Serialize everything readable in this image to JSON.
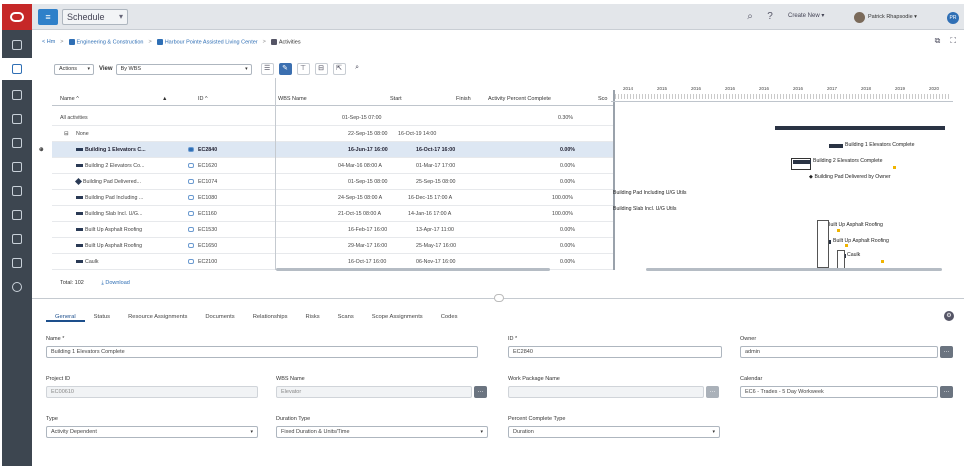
{
  "app": {
    "title": "Schedule",
    "app_icon_glyph": "≡",
    "create_new": "Create New ▾",
    "user_name": "Patrick Rhapsodie ▾",
    "user_badge": "PR"
  },
  "breadcrumb": [
    {
      "label": "< Hm",
      "icon": "back-icon"
    },
    {
      "label": "Engineering & Construction",
      "icon": "folder-icon"
    },
    {
      "label": "Harbour Pointe Assisted Living Center",
      "icon": "project-icon"
    },
    {
      "label": "Activities",
      "icon": "activities-icon"
    }
  ],
  "toolbar": {
    "actions_label": "Actions",
    "view_label": "View",
    "view_value": "By WBS",
    "buttons": [
      "☰",
      "✎",
      "⊤",
      "⊟",
      "⇱",
      "⌕"
    ]
  },
  "grid": {
    "headers": {
      "name": "Name ^",
      "id": "ID ^",
      "wbs": "WBS Name",
      "start": "Start",
      "finish": "Finish",
      "pct": "Activity Percent Complete",
      "more": "Sco"
    },
    "summary_row": {
      "name": "All activities",
      "start": "01-Sep-15 07:00",
      "pct": "0.30%"
    },
    "group_row": {
      "name": "None",
      "start": "22-Sep-15 08:00",
      "finish": "16-Oct-19 14:00"
    },
    "rows": [
      {
        "name": "Building 1 Elevators C...",
        "id": "EC2840",
        "start": "16-Jun-17 16:00",
        "finish": "16-Oct-17 16:00",
        "pct": "0.00%",
        "icon": "milestone"
      },
      {
        "name": "Building 2 Elevators Co...",
        "id": "EC1620",
        "start": "04-Mar-16 08:00 A",
        "finish": "01-Mar-17 17:00",
        "pct": "0.00%",
        "icon": "milestone"
      },
      {
        "name": "Building Pad Delivered...",
        "id": "EC1074",
        "start": "01-Sep-15 08:00",
        "finish": "25-Sep-15 08:00",
        "pct": "0.00%",
        "icon": "diamond"
      },
      {
        "name": "Building Pad Including ...",
        "id": "EC1080",
        "start": "24-Sep-15 08:00 A",
        "finish": "16-Dec-15 17:00 A",
        "pct": "100.00%",
        "icon": "milestone"
      },
      {
        "name": "Building Slab Incl. U/G...",
        "id": "EC1160",
        "start": "21-Oct-15 08:00 A",
        "finish": "14-Jan-16 17:00 A",
        "pct": "100.00%",
        "icon": "milestone"
      },
      {
        "name": "Built Up Asphalt Roofing",
        "id": "EC1530",
        "start": "16-Feb-17 16:00",
        "finish": "13-Apr-17 11:00",
        "pct": "0.00%",
        "icon": "milestone"
      },
      {
        "name": "Built Up Asphalt Roofing",
        "id": "EC1650",
        "start": "29-Mar-17 16:00",
        "finish": "25-May-17 16:00",
        "pct": "0.00%",
        "icon": "milestone"
      },
      {
        "name": "Caulk",
        "id": "EC2100",
        "start": "16-Oct-17 16:00",
        "finish": "06-Nov-17 16:00",
        "pct": "0.00%",
        "icon": "milestone"
      }
    ],
    "total_label": "Total: 102",
    "download_label": "Download"
  },
  "gantt": {
    "years": [
      "2014",
      "2015",
      "2016",
      "2016",
      "2016",
      "2016",
      "2017",
      "2018",
      "2019",
      "2020"
    ],
    "labels": [
      "Building 1 Elevators Complete",
      "Building 2 Elevators Complete",
      "Building Pad Delivered by Owner",
      "Building Pad Including U/G Utils",
      "Building Slab Incl. U/G Utils",
      "Built Up Asphalt Roofing",
      "Built Up Asphalt Roofing",
      "Caulk"
    ]
  },
  "tabs": [
    "General",
    "Status",
    "Resource Assignments",
    "Documents",
    "Relationships",
    "Risks",
    "Scans",
    "Scope Assignments",
    "Codes"
  ],
  "form": {
    "name_label": "Name *",
    "name_value": "Building 1 Elevators Complete",
    "id_label": "ID *",
    "id_value": "EC2840",
    "owner_label": "Owner",
    "owner_value": "admin",
    "project_label": "Project ID",
    "project_value": "EC00610",
    "wbs_label": "WBS Name",
    "wbs_value": "Elevator",
    "work_package_label": "Work Package Name",
    "work_package_value": "",
    "calendar_label": "Calendar",
    "calendar_value": "EC6 - Trades - 5 Day Workweek",
    "type_label": "Type",
    "type_value": "Activity Dependent",
    "duration_type_label": "Duration Type",
    "duration_type_value": "Fixed Duration & Units/Time",
    "pct_type_label": "Percent Complete Type",
    "pct_type_value": "Duration"
  }
}
